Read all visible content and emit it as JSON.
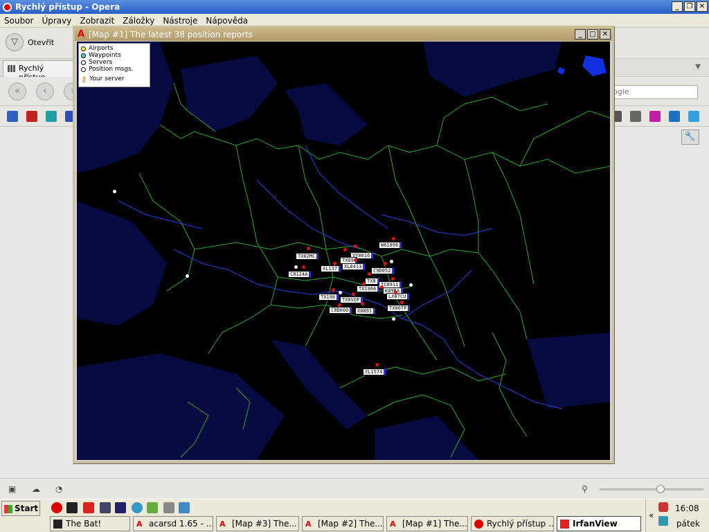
{
  "opera": {
    "title": "Rychlý přístup - Opera",
    "menu": [
      "Soubor",
      "Úpravy",
      "Zobrazit",
      "Záložky",
      "Nástroje",
      "Nápověda"
    ],
    "open_label": "Otevřít",
    "tab_label": "Rychlý přístup",
    "search_placeholder": "ogle"
  },
  "map_window": {
    "title": "[Map #1] The latest 38 position reports",
    "legend": {
      "items": [
        "Airports",
        "Waypoints",
        "Servers",
        "Position msgs."
      ],
      "server_label": "Your server",
      "colors": [
        "#ffff40",
        "#40e0e0",
        "#ffffff",
        "#ffffff"
      ]
    },
    "labels": [
      {
        "text": "TX02MC"
      },
      {
        "text": "VY0016"
      },
      {
        "text": "W61996"
      },
      {
        "text": "TX09"
      },
      {
        "text": "XL137"
      },
      {
        "text": "XL0413"
      },
      {
        "text": "C8124A"
      },
      {
        "text": "C9D052"
      },
      {
        "text": "TX0"
      },
      {
        "text": "TC0911"
      },
      {
        "text": "TX1966"
      },
      {
        "text": "K09BA"
      },
      {
        "text": "TX198"
      },
      {
        "text": "TX0SQF"
      },
      {
        "text": "LX07CU"
      },
      {
        "text": "C8D000"
      },
      {
        "text": "X0891"
      },
      {
        "text": "TX06TP"
      },
      {
        "text": "XL1574"
      }
    ]
  },
  "taskbar": {
    "start_label": "Start",
    "tasks": [
      "The Bat!",
      "acarsd 1.65 - ...",
      "[Map #3] The...",
      "[Map #2] The...",
      "[Map #1] The...",
      "Rychlý přístup ...",
      "IrfanView"
    ],
    "clock_time": "16:08",
    "clock_day": "pátek"
  }
}
